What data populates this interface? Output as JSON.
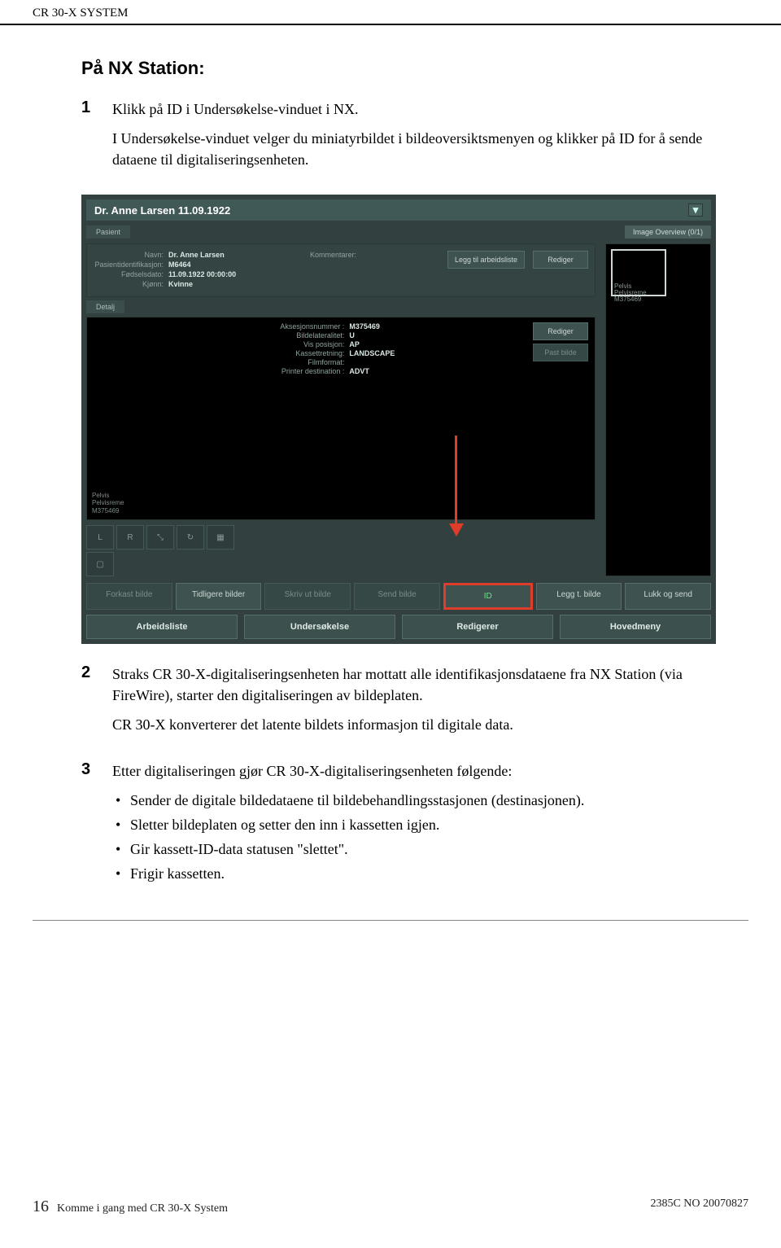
{
  "header": {
    "system": "CR 30-X SYSTEM"
  },
  "section_title": "På NX Station:",
  "steps": {
    "s1": {
      "num": "1",
      "p1": "Klikk på ID i Undersøkelse-vinduet i NX.",
      "p2": "I Undersøkelse-vinduet velger du miniatyrbildet i bildeoversiktsmenyen og klikker på ID for å sende dataene til digitaliseringsenheten."
    },
    "s2": {
      "num": "2",
      "p1": "Straks CR 30-X-digitaliseringsenheten har mottatt alle identifikasjonsdataene fra NX Station (via FireWire), starter den digitaliseringen av bildeplaten.",
      "p2": "CR 30-X konverterer det latente bildets informasjon til digitale data."
    },
    "s3": {
      "num": "3",
      "p1": "Etter digitaliseringen gjør CR 30-X-digitaliseringsenheten følgende:",
      "b1": "Sender de digitale bildedataene til bildebehandlingsstasjonen (destinasjonen).",
      "b2": "Sletter bildeplaten og setter den inn i kassetten igjen.",
      "b3": "Gir kassett-ID-data statusen \"slettet\".",
      "b4": "Frigir kassetten."
    }
  },
  "ui": {
    "title": "Dr. Anne Larsen 11.09.1922",
    "tabs": {
      "pasient": "Pasient",
      "detalj": "Detalj"
    },
    "overview_badge": "Image Overview (0/1)",
    "patient": {
      "navn_lbl": "Navn:",
      "navn": "Dr. Anne Larsen",
      "pid_lbl": "Pasientidentifikasjon:",
      "pid": "M6464",
      "fdato_lbl": "Fødselsdato:",
      "fdato": "11.09.1922 00:00:00",
      "kjonn_lbl": "Kjønn:",
      "kjonn": "Kvinne",
      "kommentar_lbl": "Kommentarer:"
    },
    "btns": {
      "legg_arb": "Legg til arbeidsliste",
      "rediger": "Rediger",
      "past_bilde": "Past bilde"
    },
    "thumb": {
      "l1": "Pelvis",
      "l2": "Pelvisreme",
      "l3": "M375469"
    },
    "detail": {
      "aksesjon_lbl": "Aksesjonsnummer :",
      "aksesjon": "M375469",
      "bildelat_lbl": "Bildelateralitet:",
      "bildelat": "U",
      "vispos_lbl": "Vis posisjon:",
      "vispos": "AP",
      "kassett_lbl": "Kassettretning:",
      "kassett": "LANDSCAPE",
      "filmf_lbl": "Filmformat:",
      "printer_lbl": "Printer destination :",
      "printer": "ADVT"
    },
    "corner": {
      "l1": "Pelvis",
      "l2": "Pelvisreme",
      "l3": "M375469"
    },
    "tools": {
      "L": "L",
      "R": "R"
    },
    "bottom": {
      "forkast": "Forkast bilde",
      "tidligere": "Tidligere bilder",
      "skriv": "Skriv ut bilde",
      "send": "Send bilde",
      "id": "ID",
      "leggt": "Legg t. bilde",
      "lukk": "Lukk og send"
    },
    "nav": {
      "arbeidsliste": "Arbeidsliste",
      "undersokelse": "Undersøkelse",
      "redigerer": "Redigerer",
      "hovedmeny": "Hovedmeny"
    }
  },
  "footer": {
    "page": "16",
    "left": "Komme i gang med CR 30-X System",
    "right": "2385C NO 20070827"
  }
}
